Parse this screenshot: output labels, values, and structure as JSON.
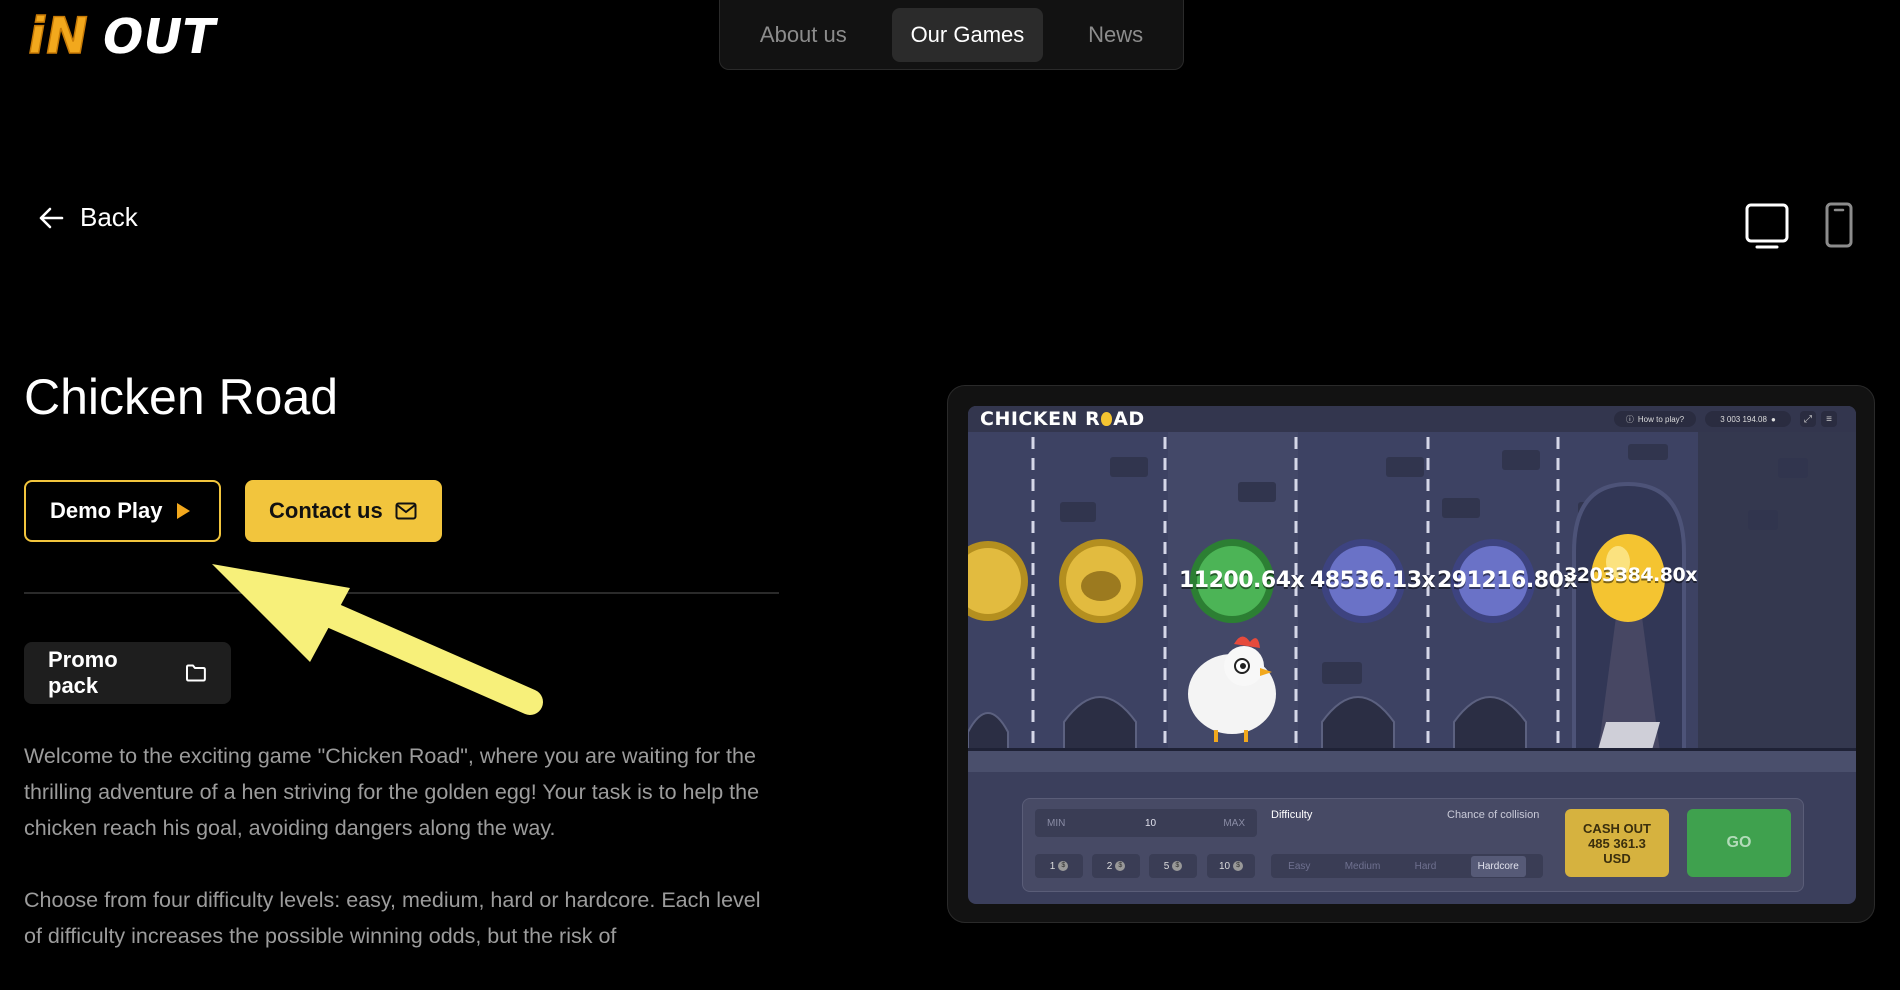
{
  "brand": {
    "logo_text_colored": "iN",
    "logo_text": "OUT",
    "accent": "#f2c53d"
  },
  "nav": [
    {
      "label": "About us",
      "active": false
    },
    {
      "label": "Our Games",
      "active": true
    },
    {
      "label": "News",
      "active": false
    }
  ],
  "back": {
    "label": "Back"
  },
  "device_toggle": {
    "desktop_icon": "monitor-icon",
    "mobile_icon": "phone-icon"
  },
  "game": {
    "title": "Chicken Road",
    "demo_label": "Demo Play",
    "contact_label": "Contact us",
    "promo_label": "Promo pack",
    "description": [
      "Welcome to the exciting game \"Chicken Road\", where you are waiting for the thrilling adventure of a hen striving for the golden egg! Your task is to help the chicken reach his goal, avoiding dangers along the way.",
      "Choose from four difficulty levels: easy, medium, hard or hardcore. Each level of difficulty increases the possible winning odds, but the risk of"
    ]
  },
  "preview": {
    "logo_a": "CHICKEN R",
    "logo_b": "AD",
    "how_to_play": "How to play?",
    "balance": "3 003 194.08",
    "multipliers": [
      "11200.64x",
      "48536.13x",
      "291216.80x",
      "3203384.80x"
    ],
    "bet": {
      "min": "MIN",
      "value": "10",
      "max": "MAX"
    },
    "chips": [
      "1",
      "2",
      "5",
      "10"
    ],
    "difficulty_label": "Difficulty",
    "chance_label": "Chance of collision",
    "difficulties": [
      "Easy",
      "Medium",
      "Hard",
      "Hardcore"
    ],
    "selected_difficulty": "Hardcore",
    "cashout_lines": [
      "CASH OUT",
      "485 361.3",
      "USD"
    ],
    "go_label": "GO"
  }
}
